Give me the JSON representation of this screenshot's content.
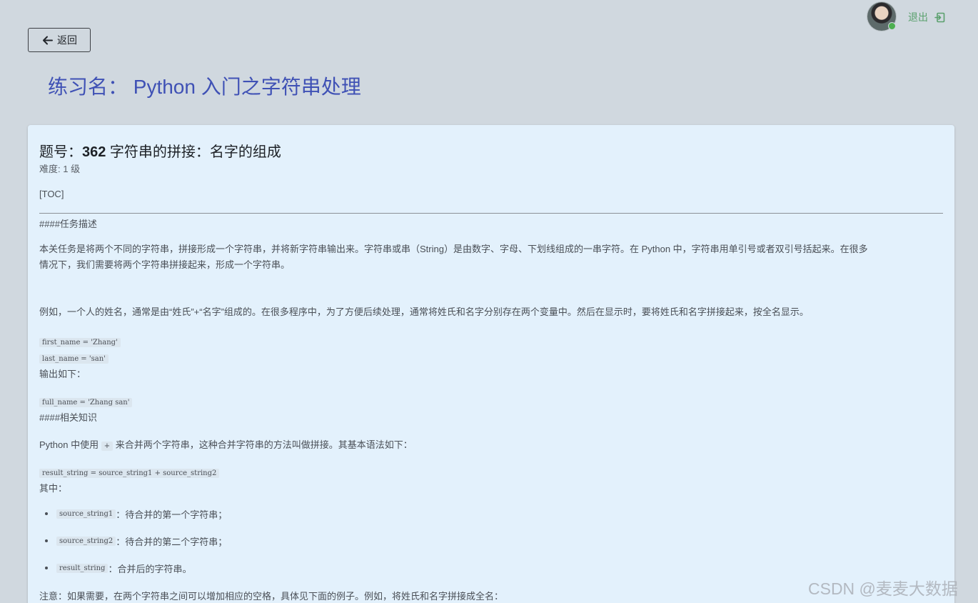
{
  "header": {
    "logout_label": "退出",
    "back_label": "返回",
    "exercise_title": "练习名： Python 入门之字符串处理"
  },
  "question": {
    "title_prefix": "题号：",
    "number": "362",
    "title": " 字符串的拼接：名字的组成",
    "difficulty": "难度: 1 级",
    "toc": "[TOC]",
    "task_heading": "####任务描述",
    "para1_line1": "本关任务是将两个不同的字符串，拼接形成一个字符串，并将新字符串输出来。字符串或串（String）是由数字、字母、下划线组成的一串字符。在 Python 中，字符串用单引号或者双引号括起来。在很多",
    "para1_line2": "情况下，我们需要将两个字符串拼接起来，形成一个字符串。",
    "para2": "例如，一个人的姓名，通常是由“姓氏”+“名字”组成的。在很多程序中，为了方便后续处理，通常将姓氏和名字分别存在两个变量中。然后在显示时，要将姓氏和名字拼接起来，按全名显示。",
    "code1": "first_name = 'Zhang'",
    "code2": "last_name = 'san'",
    "output_label": "输出如下：",
    "code3": "full_name = 'Zhang san'",
    "knowledge_heading": "####相关知识",
    "para3_before": "Python 中使用 ",
    "para3_code": "+",
    "para3_after": " 来合并两个字符串，这种合并字符串的方法叫做拼接。其基本语法如下：",
    "code4": "result_string = source_string1 + source_string2",
    "where_label": "其中：",
    "items": [
      {
        "code": "source_string1",
        "text": "：待合并的第一个字符串；"
      },
      {
        "code": "source_string2",
        "text": "：待合并的第二个字符串；"
      },
      {
        "code": "result_string",
        "text": "：合并后的字符串。"
      }
    ],
    "note": "注意：如果需要，在两个字符串之间可以增加相应的空格，具体见下面的例子。例如，将姓氏和名字拼接成全名："
  },
  "watermark": "CSDN @麦麦大数据",
  "colors": {
    "page_bg": "#d0d8df",
    "card_bg": "#e3f1fc",
    "title_blue": "#3f51b5",
    "logout_green": "#5aa06d",
    "status_dot": "#4caf50"
  },
  "icons": {
    "back": "arrow-left-icon",
    "logout": "logout-icon"
  }
}
